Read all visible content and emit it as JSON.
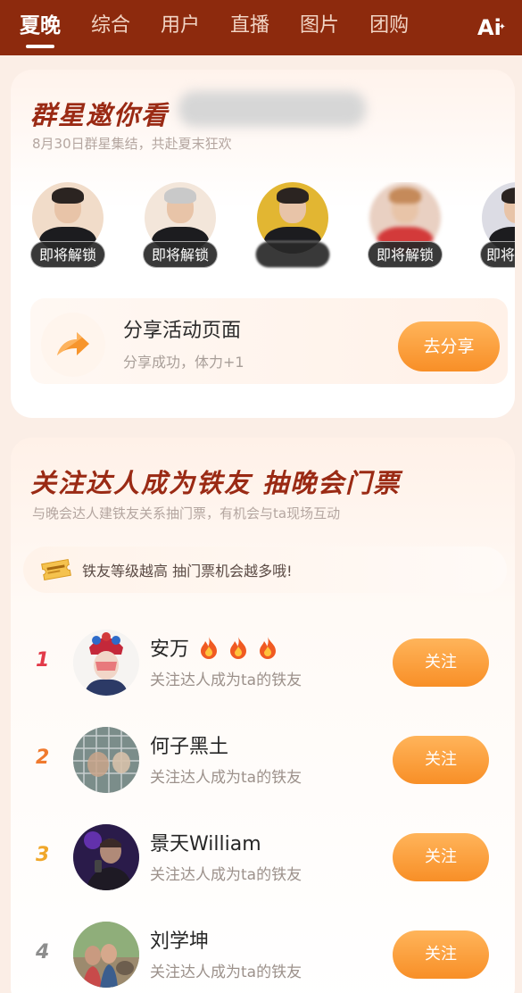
{
  "tabs": [
    "夏晚",
    "综合",
    "用户",
    "直播",
    "图片",
    "团购"
  ],
  "active_tab": "夏晚",
  "ai_label": "Ai",
  "event": {
    "title": "群星邀你看",
    "subtitle": "8月30日群星集结，共赴夏末狂欢",
    "stars": [
      {
        "badge": "即将解锁",
        "icon": "star-avatar-icon"
      },
      {
        "badge": "即将解锁",
        "icon": "star-avatar-icon"
      },
      {
        "badge": "",
        "icon": "star-avatar-icon"
      },
      {
        "badge": "即将解锁",
        "icon": "star-avatar-icon"
      },
      {
        "badge": "即将",
        "icon": "star-avatar-icon"
      }
    ],
    "share": {
      "title": "分享活动页面",
      "desc": "分享成功，体力+1",
      "button": "去分享",
      "icon": "share-arrow-icon"
    }
  },
  "follow": {
    "title": "关注达人成为铁友 抽晚会门票",
    "subtitle": "与晚会达人建铁友关系抽门票，有机会与ta现场互动",
    "tip": "铁友等级越高 抽门票机会越多哦!",
    "tip_icon": "ticket-icon",
    "rank_colors": [
      "#e23a49",
      "#f07a2e",
      "#f0a72a",
      "#8d8d8d"
    ],
    "list": [
      {
        "rank": "1",
        "name": "安万",
        "flames": 3,
        "desc": "关注达人成为ta的铁友",
        "button": "关注"
      },
      {
        "rank": "2",
        "name": "何子黑土",
        "flames": 0,
        "desc": "关注达人成为ta的铁友",
        "button": "关注"
      },
      {
        "rank": "3",
        "name": "景天William",
        "flames": 0,
        "desc": "关注达人成为ta的铁友",
        "button": "关注"
      },
      {
        "rank": "4",
        "name": "刘学坤",
        "flames": 0,
        "desc": "关注达人成为ta的铁友",
        "button": "关注"
      }
    ]
  }
}
